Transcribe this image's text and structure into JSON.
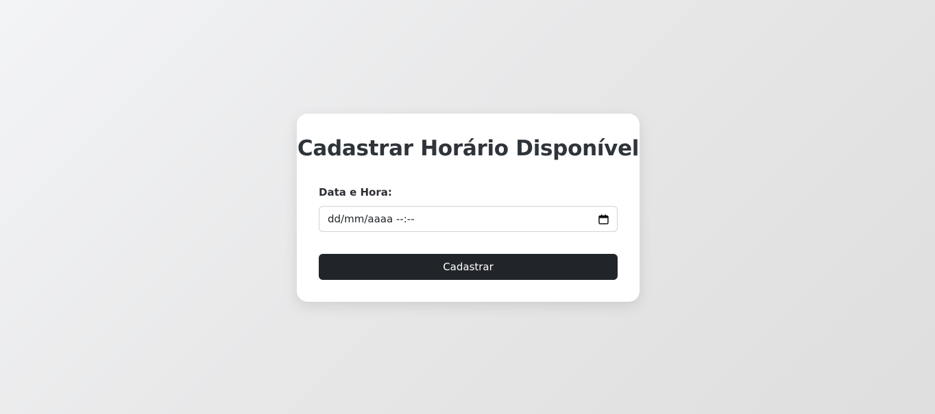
{
  "form": {
    "title": "Cadastrar Horário Disponível",
    "datetime_label": "Data e Hora:",
    "datetime_placeholder": "dd/mm/aaaa --:--",
    "submit_label": "Cadastrar"
  },
  "icons": {
    "datetime_picker": "calendar-icon"
  },
  "colors": {
    "button_bg": "#212529",
    "title_text": "#2f343a"
  }
}
